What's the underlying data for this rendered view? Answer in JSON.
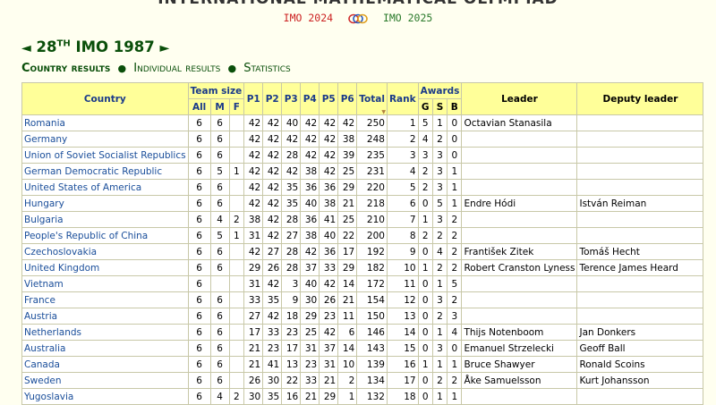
{
  "header": {
    "site_title": "INTERNATIONAL MATHEMATICAL OLYMPIAD",
    "prev_imo": "IMO 2024",
    "next_imo": "IMO 2025",
    "logo_icon": "imo-rings-logo-icon"
  },
  "page": {
    "prev_arrow": "◄",
    "next_arrow": "►",
    "title_num": "28",
    "title_sup": "TH",
    "title_rest": "IMO 1987"
  },
  "subnav": {
    "current": "Country results",
    "individual": "Individual results",
    "statistics": "Statistics"
  },
  "table": {
    "headers": {
      "country": "Country",
      "team_size": "Team size",
      "all": "All",
      "m": "M",
      "f": "F",
      "p1": "P1",
      "p2": "P2",
      "p3": "P3",
      "p4": "P4",
      "p5": "P5",
      "p6": "P6",
      "total": "Total",
      "rank": "Rank",
      "awards": "Awards",
      "g": "G",
      "s": "S",
      "b": "B",
      "leader": "Leader",
      "deputy": "Deputy leader"
    },
    "rows": [
      {
        "country": "Romania",
        "all": "6",
        "m": "6",
        "f": "",
        "p1": "42",
        "p2": "42",
        "p3": "40",
        "p4": "42",
        "p5": "42",
        "p6": "42",
        "total": "250",
        "rank": "1",
        "g": "5",
        "s": "1",
        "b": "0",
        "leader": "Octavian Stanasila",
        "deputy": ""
      },
      {
        "country": "Germany",
        "all": "6",
        "m": "6",
        "f": "",
        "p1": "42",
        "p2": "42",
        "p3": "42",
        "p4": "42",
        "p5": "42",
        "p6": "38",
        "total": "248",
        "rank": "2",
        "g": "4",
        "s": "2",
        "b": "0",
        "leader": "",
        "deputy": ""
      },
      {
        "country": "Union of Soviet Socialist Republics",
        "all": "6",
        "m": "6",
        "f": "",
        "p1": "42",
        "p2": "42",
        "p3": "28",
        "p4": "42",
        "p5": "42",
        "p6": "39",
        "total": "235",
        "rank": "3",
        "g": "3",
        "s": "3",
        "b": "0",
        "leader": "",
        "deputy": ""
      },
      {
        "country": "German Democratic Republic",
        "all": "6",
        "m": "5",
        "f": "1",
        "p1": "42",
        "p2": "42",
        "p3": "42",
        "p4": "38",
        "p5": "42",
        "p6": "25",
        "total": "231",
        "rank": "4",
        "g": "2",
        "s": "3",
        "b": "1",
        "leader": "",
        "deputy": ""
      },
      {
        "country": "United States of America",
        "all": "6",
        "m": "6",
        "f": "",
        "p1": "42",
        "p2": "42",
        "p3": "35",
        "p4": "36",
        "p5": "36",
        "p6": "29",
        "total": "220",
        "rank": "5",
        "g": "2",
        "s": "3",
        "b": "1",
        "leader": "",
        "deputy": ""
      },
      {
        "country": "Hungary",
        "all": "6",
        "m": "6",
        "f": "",
        "p1": "42",
        "p2": "42",
        "p3": "35",
        "p4": "40",
        "p5": "38",
        "p6": "21",
        "total": "218",
        "rank": "6",
        "g": "0",
        "s": "5",
        "b": "1",
        "leader": "Endre Hódi",
        "deputy": "István Reiman"
      },
      {
        "country": "Bulgaria",
        "all": "6",
        "m": "4",
        "f": "2",
        "p1": "38",
        "p2": "42",
        "p3": "28",
        "p4": "36",
        "p5": "41",
        "p6": "25",
        "total": "210",
        "rank": "7",
        "g": "1",
        "s": "3",
        "b": "2",
        "leader": "",
        "deputy": ""
      },
      {
        "country": "People's Republic of China",
        "all": "6",
        "m": "5",
        "f": "1",
        "p1": "31",
        "p2": "42",
        "p3": "27",
        "p4": "38",
        "p5": "40",
        "p6": "22",
        "total": "200",
        "rank": "8",
        "g": "2",
        "s": "2",
        "b": "2",
        "leader": "",
        "deputy": ""
      },
      {
        "country": "Czechoslovakia",
        "all": "6",
        "m": "6",
        "f": "",
        "p1": "42",
        "p2": "27",
        "p3": "28",
        "p4": "42",
        "p5": "36",
        "p6": "17",
        "total": "192",
        "rank": "9",
        "g": "0",
        "s": "4",
        "b": "2",
        "leader": "František Zitek",
        "deputy": "Tomáš Hecht"
      },
      {
        "country": "United Kingdom",
        "all": "6",
        "m": "6",
        "f": "",
        "p1": "29",
        "p2": "26",
        "p3": "28",
        "p4": "37",
        "p5": "33",
        "p6": "29",
        "total": "182",
        "rank": "10",
        "g": "1",
        "s": "2",
        "b": "2",
        "leader": "Robert Cranston Lyness",
        "deputy": "Terence James Heard"
      },
      {
        "country": "Vietnam",
        "all": "6",
        "m": "",
        "f": "",
        "p1": "31",
        "p2": "42",
        "p3": "3",
        "p4": "40",
        "p5": "42",
        "p6": "14",
        "total": "172",
        "rank": "11",
        "g": "0",
        "s": "1",
        "b": "5",
        "leader": "",
        "deputy": ""
      },
      {
        "country": "France",
        "all": "6",
        "m": "6",
        "f": "",
        "p1": "33",
        "p2": "35",
        "p3": "9",
        "p4": "30",
        "p5": "26",
        "p6": "21",
        "total": "154",
        "rank": "12",
        "g": "0",
        "s": "3",
        "b": "2",
        "leader": "",
        "deputy": ""
      },
      {
        "country": "Austria",
        "all": "6",
        "m": "6",
        "f": "",
        "p1": "27",
        "p2": "42",
        "p3": "18",
        "p4": "29",
        "p5": "23",
        "p6": "11",
        "total": "150",
        "rank": "13",
        "g": "0",
        "s": "2",
        "b": "3",
        "leader": "",
        "deputy": ""
      },
      {
        "country": "Netherlands",
        "all": "6",
        "m": "6",
        "f": "",
        "p1": "17",
        "p2": "33",
        "p3": "23",
        "p4": "25",
        "p5": "42",
        "p6": "6",
        "total": "146",
        "rank": "14",
        "g": "0",
        "s": "1",
        "b": "4",
        "leader": "Thijs Notenboom",
        "deputy": "Jan Donkers"
      },
      {
        "country": "Australia",
        "all": "6",
        "m": "6",
        "f": "",
        "p1": "21",
        "p2": "23",
        "p3": "17",
        "p4": "31",
        "p5": "37",
        "p6": "14",
        "total": "143",
        "rank": "15",
        "g": "0",
        "s": "3",
        "b": "0",
        "leader": "Emanuel Strzelecki",
        "deputy": "Geoff Ball"
      },
      {
        "country": "Canada",
        "all": "6",
        "m": "6",
        "f": "",
        "p1": "21",
        "p2": "41",
        "p3": "13",
        "p4": "23",
        "p5": "31",
        "p6": "10",
        "total": "139",
        "rank": "16",
        "g": "1",
        "s": "1",
        "b": "1",
        "leader": "Bruce Shawyer",
        "deputy": "Ronald Scoins"
      },
      {
        "country": "Sweden",
        "all": "6",
        "m": "6",
        "f": "",
        "p1": "26",
        "p2": "30",
        "p3": "22",
        "p4": "33",
        "p5": "21",
        "p6": "2",
        "total": "134",
        "rank": "17",
        "g": "0",
        "s": "2",
        "b": "2",
        "leader": "Åke Samuelsson",
        "deputy": "Kurt Johansson"
      },
      {
        "country": "Yugoslavia",
        "all": "6",
        "m": "4",
        "f": "2",
        "p1": "30",
        "p2": "35",
        "p3": "16",
        "p4": "21",
        "p5": "29",
        "p6": "1",
        "total": "132",
        "rank": "18",
        "g": "0",
        "s": "1",
        "b": "1",
        "leader": "",
        "deputy": ""
      }
    ]
  }
}
